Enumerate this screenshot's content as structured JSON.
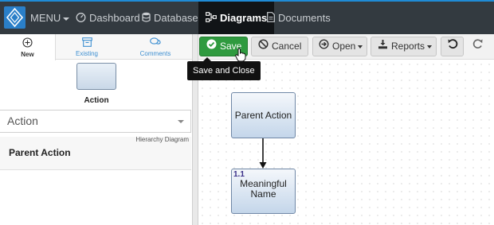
{
  "app": {
    "colors": {
      "nav_bg": "#333a40",
      "active_bg": "#111417",
      "accent": "#2a7fc8",
      "save_green": "#2f9a3f"
    }
  },
  "nav": {
    "logo_icon": "diamond-logo-icon",
    "menu_label": "MENU",
    "items": [
      {
        "label": "Dashboard",
        "icon": "dashboard-icon"
      },
      {
        "label": "Database",
        "icon": "database-icon"
      },
      {
        "label": "Diagrams",
        "icon": "diagram-icon",
        "active": true
      },
      {
        "label": "Documents",
        "icon": "document-icon"
      }
    ]
  },
  "left_panel": {
    "tabs": [
      {
        "label": "New",
        "icon": "plus-circle-icon",
        "active": true
      },
      {
        "label": "Existing",
        "icon": "archive-icon"
      },
      {
        "label": "Comments",
        "icon": "comments-icon"
      }
    ],
    "shape_label": "Action",
    "type_select": {
      "value": "Action"
    },
    "diagram_type_label": "Hierarchy Diagram",
    "parent_label": "Parent Action"
  },
  "toolbar": {
    "save_label": "Save",
    "cancel_label": "Cancel",
    "open_label": "Open",
    "reports_label": "Reports",
    "tooltip": "Save and Close"
  },
  "diagram": {
    "parent_node": "Parent Action",
    "child_node": {
      "number": "1.1",
      "label_line1": "Meaningful",
      "label_line2": "Name"
    }
  }
}
